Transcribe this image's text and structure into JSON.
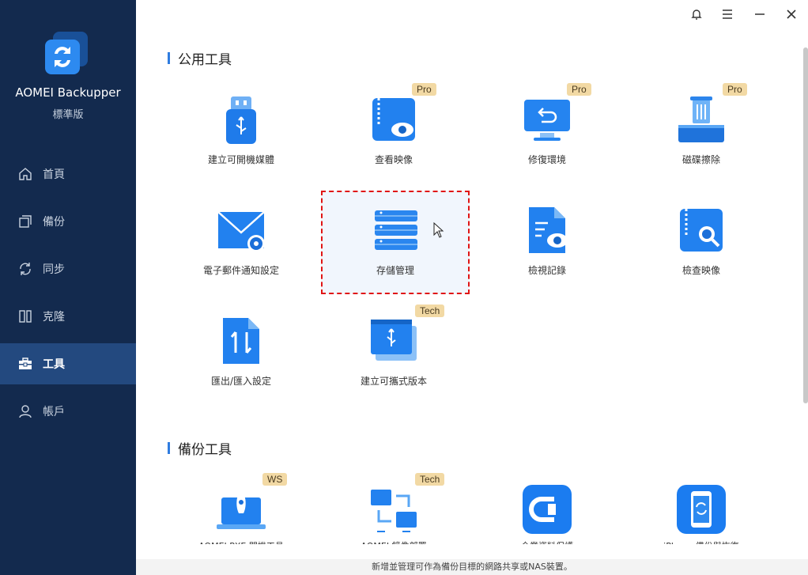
{
  "app": {
    "name": "AOMEI Backupper",
    "edition": "標準版"
  },
  "nav": [
    {
      "label": "首頁",
      "icon": "home-icon"
    },
    {
      "label": "備份",
      "icon": "backup-icon"
    },
    {
      "label": "同步",
      "icon": "sync-icon"
    },
    {
      "label": "克隆",
      "icon": "clone-icon"
    },
    {
      "label": "工具",
      "icon": "toolbox-icon",
      "active": true
    },
    {
      "label": "帳戶",
      "icon": "user-icon"
    }
  ],
  "titlebar": {
    "icons": [
      "bell-icon",
      "menu-icon",
      "minimize-icon",
      "close-icon"
    ]
  },
  "sections": {
    "common_title": "公用工具",
    "backup_title": "備份工具"
  },
  "common_tools": [
    {
      "label": "建立可開機媒體",
      "icon": "usb-drive-icon",
      "badge": ""
    },
    {
      "label": "查看映像",
      "icon": "view-image-icon",
      "badge": "Pro"
    },
    {
      "label": "修復環境",
      "icon": "recovery-env-icon",
      "badge": "Pro"
    },
    {
      "label": "磁碟擦除",
      "icon": "disk-wipe-icon",
      "badge": "Pro"
    },
    {
      "label": "電子郵件通知設定",
      "icon": "email-settings-icon",
      "badge": ""
    },
    {
      "label": "存儲管理",
      "icon": "storage-server-icon",
      "badge": "",
      "selected": true
    },
    {
      "label": "檢視記錄",
      "icon": "view-logs-icon",
      "badge": ""
    },
    {
      "label": "檢查映像",
      "icon": "check-image-icon",
      "badge": ""
    },
    {
      "label": "匯出/匯入設定",
      "icon": "export-import-icon",
      "badge": ""
    },
    {
      "label": "建立可攜式版本",
      "icon": "portable-version-icon",
      "badge": "Tech"
    }
  ],
  "backup_tools": [
    {
      "label": "AOMEI PXE 開機工具",
      "icon": "pxe-rocket-icon",
      "badge": "WS"
    },
    {
      "label": "AOMEI 鏡像部署",
      "icon": "image-deploy-icon",
      "badge": "Tech"
    },
    {
      "label": "企業資料保護",
      "icon": "centralized-backup-icon",
      "badge": ""
    },
    {
      "label": "iPhone 備份與恢復",
      "icon": "phone-backup-icon",
      "badge": ""
    }
  ],
  "status_text": "新增並管理可作為備份目標的網路共享或NAS裝置。",
  "colors": {
    "sidebar_bg": "#132a4e",
    "sidebar_active": "#23497f",
    "accent": "#2f7ce0",
    "badge_bg": "#f2d9a4",
    "selection_border": "#e01515"
  }
}
